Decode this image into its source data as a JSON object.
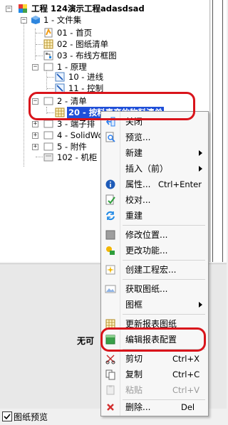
{
  "project": {
    "label": "工程 124演示工程adasdsad"
  },
  "tree": {
    "folder_docs": "1 - 文件集",
    "doc_home": "01 - 首页",
    "doc_list": "02 - 图纸清单",
    "doc_frame": "03 - 布线方框图",
    "folder_schematic": "1 - 原理",
    "sch_incoming": "10 - 进线",
    "sch_control": "11 - 控制",
    "folder_list": "2 - 清单",
    "list_selected": "20 - 按料表变的物料清单",
    "folder_terminal": "3 - 端子排",
    "folder_solidworks": "4 - SolidWor",
    "folder_attach": "5 - 附件",
    "cabinet": "102 - 机柜"
  },
  "preview": {
    "text": "无可"
  },
  "bottom": {
    "preview_label": "图纸预览"
  },
  "menu": {
    "close": "关闭",
    "preview": "预览...",
    "new": "新建",
    "insert": "插入（前）",
    "properties": "属性...",
    "properties_sc": "Ctrl+Enter",
    "proofread": "校对...",
    "rebuild": "重建",
    "modify_location": "修改位置...",
    "change_function": "更改功能...",
    "create_macro": "创建工程宏...",
    "get_drawing": "获取图纸...",
    "frame": "图框",
    "update_report": "更新报表图纸",
    "edit_report_config": "编辑报表配置",
    "cut": "剪切",
    "cut_sc": "Ctrl+X",
    "copy": "复制",
    "copy_sc": "Ctrl+C",
    "paste": "粘贴",
    "paste_sc": "Ctrl+V",
    "delete": "删除...",
    "delete_sc": "Del"
  },
  "colors": {
    "selection": "#1f4fd8",
    "annotation_ring": "#d9141b"
  }
}
